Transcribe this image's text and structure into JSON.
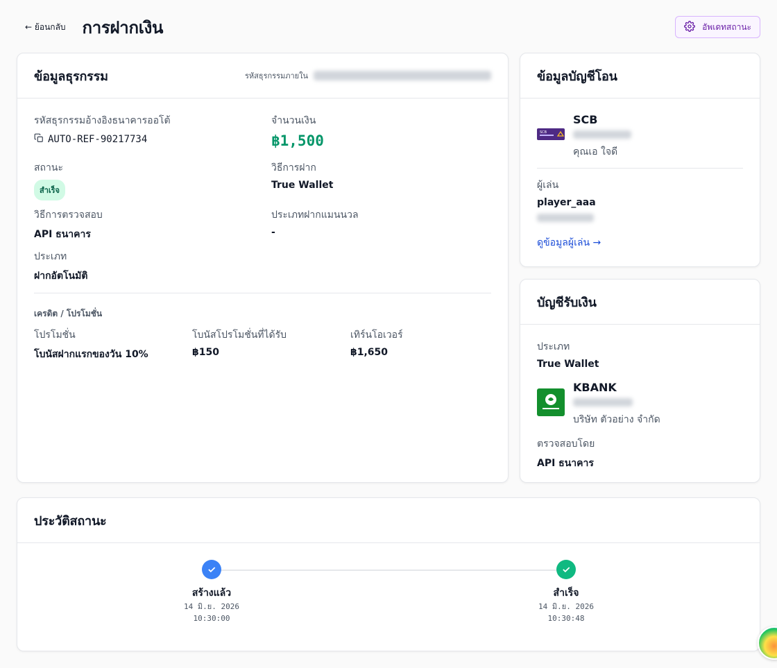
{
  "header": {
    "back_label": "← ย้อนกลับ",
    "title": "การฝากเงิน",
    "update_button_label": "อัพเดทสถานะ"
  },
  "transaction": {
    "title": "ข้อมูลธุรกรรม",
    "internal_id_label": "รหัสธุรกรรมภายใน",
    "auto_ref_label": "รหัสธุรกรรมอ้างอิงธนาคารออโต้",
    "auto_ref_value": "AUTO-REF-90217734",
    "amount_label": "จำนวนเงิน",
    "amount_value": "฿1,500",
    "status_label": "สถานะ",
    "status_value": "สำเร็จ",
    "deposit_method_label": "วิธีการฝาก",
    "deposit_method_value": "True Wallet",
    "verify_method_label": "วิธีการตรวจสอบ",
    "verify_method_value": "API ธนาคาร",
    "manual_type_label": "ประเภทฝากแมนนวล",
    "manual_type_value": "-",
    "type_label": "ประเภท",
    "type_value": "ฝากอัตโนมัติ",
    "credit_section_label": "เครดิต / โปรโมชั่น",
    "promo_label": "โปรโมชั่น",
    "promo_value": "โบนัสฝากแรกของวัน 10%",
    "bonus_label": "โบนัสโปรโมชั่นที่ได้รับ",
    "bonus_value": "฿150",
    "turnover_label": "เทิร์นโอเวอร์",
    "turnover_value": "฿1,650"
  },
  "transfer_account": {
    "title": "ข้อมูลบัญชีโอน",
    "bank_code": "SCB",
    "account_name": "คุณเอ ใจดี",
    "player_label": "ผู้เล่น",
    "player_value": "player_aaa",
    "view_player_link": "ดูข้อมูลผู้เล่น →"
  },
  "receive_account": {
    "title": "บัญชีรับเงิน",
    "type_label": "ประเภท",
    "type_value": "True Wallet",
    "bank_code": "KBANK",
    "account_name": "บริษัท ตัวอย่าง จำกัด",
    "verified_by_label": "ตรวจสอบโดย",
    "verified_by_value": "API ธนาคาร"
  },
  "history": {
    "title": "ประวัติสถานะ",
    "steps": [
      {
        "label": "สร้างแล้ว",
        "date": "14 มิ.ย. 2026",
        "time": "10:30:00",
        "color": "#3b82f6"
      },
      {
        "label": "สำเร็จ",
        "date": "14 มิ.ย. 2026",
        "time": "10:30:48",
        "color": "#10b981"
      }
    ]
  },
  "colors": {
    "accent_purple": "#6b21a8",
    "amount_green": "#059669",
    "scb_purple": "#4e2a84",
    "kbank_green": "#138f2d",
    "link_blue": "#1d4ed8"
  }
}
